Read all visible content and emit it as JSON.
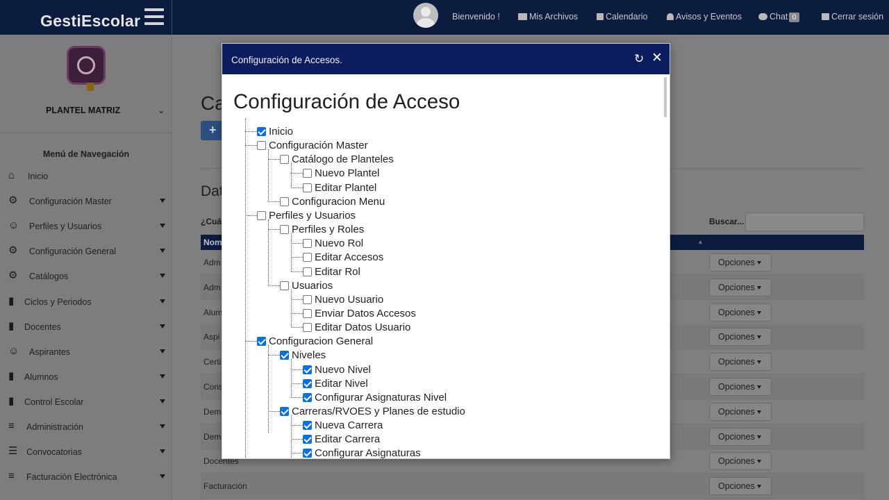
{
  "app": {
    "brand": "GestiEscolar"
  },
  "topnav": {
    "welcome": "Bienvenido !",
    "files": "Mis Archivos",
    "calendar": "Calendario",
    "notices": "Avisos y Eventos",
    "chat": "Chat",
    "chat_count": "0",
    "logout": "Cerrar sesión"
  },
  "sidebar": {
    "plantel": "PLANTEL MATRIZ",
    "menu_title": "Menú de Navegación",
    "items": [
      {
        "label": "Inicio",
        "icon": "home-icon"
      },
      {
        "label": "Configuración Master",
        "icon": "gears-icon"
      },
      {
        "label": "Perfiles y Usuarios",
        "icon": "users-icon"
      },
      {
        "label": "Configuración General",
        "icon": "gears-icon"
      },
      {
        "label": "Catálogos",
        "icon": "gears-icon"
      },
      {
        "label": "Ciclos y Periodos",
        "icon": "book-icon"
      },
      {
        "label": "Docentes",
        "icon": "book-icon"
      },
      {
        "label": "Aspirantes",
        "icon": "users-icon"
      },
      {
        "label": "Alumnos",
        "icon": "book-icon"
      },
      {
        "label": "Control Escolar",
        "icon": "book-icon"
      },
      {
        "label": "Administración",
        "icon": "coins-icon"
      },
      {
        "label": "Convocatorias",
        "icon": "list-icon"
      },
      {
        "label": "Facturación Electrónica",
        "icon": "coins-icon"
      }
    ]
  },
  "main": {
    "page_title": "Ca",
    "add_label": "+",
    "section_title": "Dat",
    "show_label": "¿Cuá",
    "search_label": "Buscar...",
    "column_header": "Nom",
    "rows": [
      {
        "name": "Adm",
        "options": "Opciones"
      },
      {
        "name": "Adm",
        "options": "Opciones"
      },
      {
        "name": "Alum",
        "options": "Opciones"
      },
      {
        "name": "Aspi",
        "options": "Opciones"
      },
      {
        "name": "Certi",
        "options": "Opciones"
      },
      {
        "name": "Cons",
        "options": "Opciones"
      },
      {
        "name": "Dem",
        "options": "Opciones"
      },
      {
        "name": "Dem",
        "options": "Opciones"
      },
      {
        "name": "Docentes",
        "options": "Opciones"
      },
      {
        "name": "Facturación",
        "options": "Opciones"
      }
    ]
  },
  "modal": {
    "title": "Configuración de Accesos.",
    "heading": "Configuración de Acceso",
    "tree": [
      {
        "label": "Inicio",
        "level": 0,
        "checked": true
      },
      {
        "label": "Configuración Master",
        "level": 0,
        "checked": false
      },
      {
        "label": "Catálogo de Planteles",
        "level": 1,
        "checked": false
      },
      {
        "label": "Nuevo Plantel",
        "level": 2,
        "checked": false
      },
      {
        "label": "Editar Plantel",
        "level": 2,
        "checked": false
      },
      {
        "label": "Configuracion Menu",
        "level": 1,
        "checked": false
      },
      {
        "label": "Perfiles y Usuarios",
        "level": 0,
        "checked": false
      },
      {
        "label": "Perfiles y Roles",
        "level": 1,
        "checked": false
      },
      {
        "label": "Nuevo Rol",
        "level": 2,
        "checked": false
      },
      {
        "label": "Editar Accesos",
        "level": 2,
        "checked": false
      },
      {
        "label": "Editar Rol",
        "level": 2,
        "checked": false
      },
      {
        "label": "Usuarios",
        "level": 1,
        "checked": false
      },
      {
        "label": "Nuevo Usuario",
        "level": 2,
        "checked": false
      },
      {
        "label": "Enviar Datos Accesos",
        "level": 2,
        "checked": false
      },
      {
        "label": "Editar Datos Usuario",
        "level": 2,
        "checked": false
      },
      {
        "label": "Configuracion General",
        "level": 0,
        "checked": true
      },
      {
        "label": "Niveles",
        "level": 1,
        "checked": true
      },
      {
        "label": "Nuevo Nivel",
        "level": 2,
        "checked": true
      },
      {
        "label": "Editar Nivel",
        "level": 2,
        "checked": true
      },
      {
        "label": "Configurar Asignaturas Nivel",
        "level": 2,
        "checked": true
      },
      {
        "label": "Carreras/RVOES y Planes de estudio",
        "level": 1,
        "checked": true
      },
      {
        "label": "Nueva Carrera",
        "level": 2,
        "checked": true
      },
      {
        "label": "Editar Carrera",
        "level": 2,
        "checked": true
      },
      {
        "label": "Configurar Asignaturas",
        "level": 2,
        "checked": true
      }
    ]
  }
}
